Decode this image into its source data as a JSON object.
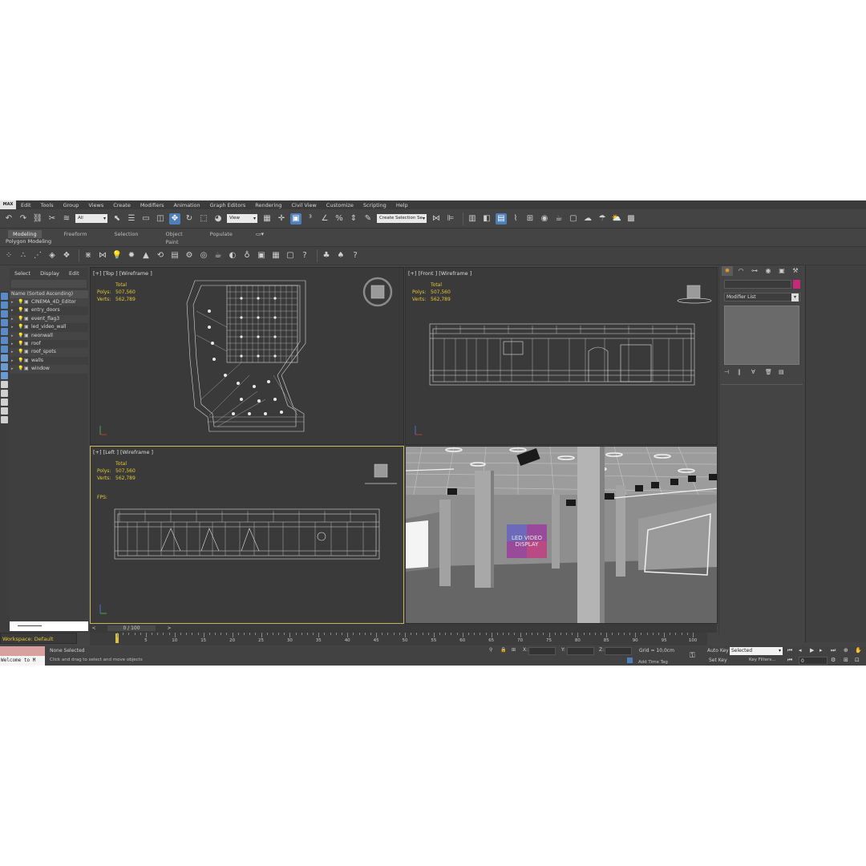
{
  "menu": {
    "logo": "MAX",
    "items": [
      "Edit",
      "Tools",
      "Group",
      "Views",
      "Create",
      "Modifiers",
      "Animation",
      "Graph Editors",
      "Rendering",
      "Civil View",
      "Customize",
      "Scripting",
      "Help"
    ]
  },
  "toolbar": {
    "filter_value": "All",
    "reference_value": "View",
    "selection_set_placeholder": "Create Selection Se"
  },
  "ribbon": {
    "tabs": [
      "Modeling",
      "Freeform",
      "Selection",
      "Object Paint",
      "Populate"
    ],
    "active_tab": "Modeling",
    "panel_label": "Polygon Modeling"
  },
  "scene_explorer": {
    "tabs": [
      "Select",
      "Display",
      "Edit"
    ],
    "header": "Name (Sorted Ascending)",
    "items": [
      "CINEMA_4D_Editor",
      "entry_doors",
      "event_flag3",
      "led_video_wall",
      "neonwall",
      "roof",
      "roof_spots",
      "walls",
      "window"
    ]
  },
  "viewports": {
    "top": {
      "label": "[+] [Top ] [Wireframe ]"
    },
    "front": {
      "label": "[+] [Front ] [Wireframe ]"
    },
    "left": {
      "label": "[+] [Left ] [Wireframe ]",
      "fps_label": "FPS:"
    },
    "perspective": {
      "screen_line1": "LED VIDEO",
      "screen_line2": "DISPLAY"
    }
  },
  "stats": {
    "title": "Total",
    "polys_label": "Polys:",
    "polys_value": "507,560",
    "verts_label": "Verts:",
    "verts_value": "562,789"
  },
  "command_panel": {
    "modifier_list_label": "Modifier List",
    "accent_color": "#c8287a"
  },
  "timeline": {
    "frame_display": "0 / 100",
    "ticks": [
      "5",
      "10",
      "15",
      "20",
      "25",
      "30",
      "35",
      "40",
      "45",
      "50",
      "55",
      "60",
      "65",
      "70",
      "75",
      "80",
      "85",
      "90",
      "95",
      "100"
    ]
  },
  "workspace": {
    "label": "Workspace: Default"
  },
  "status": {
    "maxscript": "Welcome to M",
    "selection": "None Selected",
    "prompt": "Click and drag to select and move objects",
    "x_label": "X:",
    "y_label": "Y:",
    "z_label": "Z:",
    "grid": "Grid = 10,0cm",
    "add_time_tag": "Add Time Tag",
    "auto_key": "Auto Key",
    "set_key": "Set Key",
    "selected_value": "Selected",
    "key_filters": "Key Filters...",
    "current_frame": "0"
  }
}
